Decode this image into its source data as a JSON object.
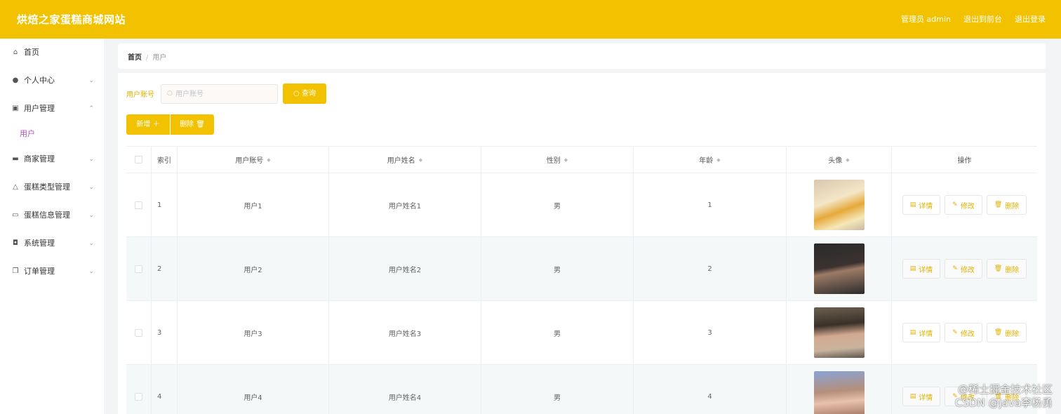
{
  "header": {
    "title": "烘焙之家蛋糕商城网站",
    "links": [
      "管理员 admin",
      "退出到前台",
      "退出登录"
    ]
  },
  "sidebar": {
    "items": [
      {
        "label": "首页",
        "icon": "home-icon",
        "has_chevron": false
      },
      {
        "label": "个人中心",
        "icon": "user-icon",
        "has_chevron": true
      },
      {
        "label": "用户管理",
        "icon": "folder-icon",
        "has_chevron": true,
        "expanded": true,
        "children": [
          "用户"
        ]
      },
      {
        "label": "商家管理",
        "icon": "monitor-icon",
        "has_chevron": true
      },
      {
        "label": "蛋糕类型管理",
        "icon": "bell-icon",
        "has_chevron": true
      },
      {
        "label": "蛋糕信息管理",
        "icon": "chat-icon",
        "has_chevron": true
      },
      {
        "label": "系统管理",
        "icon": "lightbulb-icon",
        "has_chevron": true
      },
      {
        "label": "订单管理",
        "icon": "copy-icon",
        "has_chevron": true
      }
    ]
  },
  "breadcrumb": {
    "home": "首页",
    "current": "用户"
  },
  "search": {
    "label": "用户账号",
    "placeholder": "用户账号",
    "value": "",
    "button": "查询"
  },
  "toolbar": {
    "add": "新增",
    "delete": "删除"
  },
  "table": {
    "headers": [
      "索引",
      "用户账号",
      "用户姓名",
      "性别",
      "年龄",
      "头像",
      "操作"
    ],
    "sortable": [
      false,
      true,
      true,
      true,
      true,
      true,
      false
    ],
    "rows": [
      {
        "index": "1",
        "account": "用户1",
        "name": "用户姓名1",
        "gender": "男",
        "age": "1",
        "avatar": "cake-photo"
      },
      {
        "index": "2",
        "account": "用户2",
        "name": "用户姓名2",
        "gender": "男",
        "age": "2",
        "avatar": "person-photo"
      },
      {
        "index": "3",
        "account": "用户3",
        "name": "用户姓名3",
        "gender": "男",
        "age": "3",
        "avatar": "person-photo"
      },
      {
        "index": "4",
        "account": "用户4",
        "name": "用户姓名4",
        "gender": "男",
        "age": "4",
        "avatar": "person-photo"
      }
    ],
    "actions": [
      "详情",
      "修改",
      "删除"
    ]
  },
  "watermark": [
    "@稀土掘金技术社区",
    "CSDN @java李杨勇"
  ],
  "colors": {
    "accent": "#f2c200",
    "active_menu": "#b24fc0",
    "row_alt": "#f5f8f8"
  }
}
